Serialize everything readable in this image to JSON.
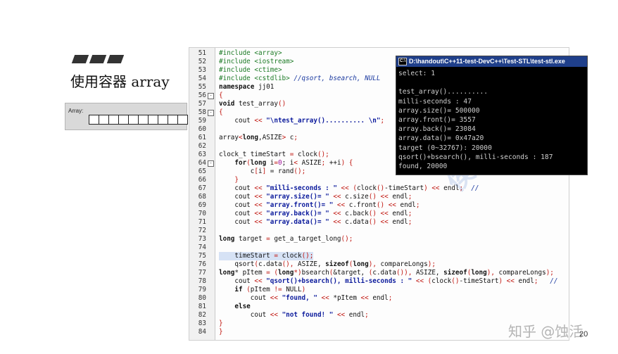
{
  "slide": {
    "title": "使用容器 array",
    "array_label": "Array:",
    "array_cells": 10,
    "page_number": "20",
    "site_watermark": "知乎 @蚀活"
  },
  "console": {
    "title": "D:\\handout\\C++11-test-DevC++\\Test-STL\\test-stl.exe",
    "lines": [
      "select: 1",
      "",
      "test_array()..........",
      "milli-seconds : 47",
      "array.size()= 500000",
      "array.front()= 3557",
      "array.back()= 23084",
      "array.data()= 0x47a20",
      "target (0~32767): 20000",
      "qsort()+bsearch(), milli-seconds : 187",
      "found, 20000"
    ]
  },
  "code": {
    "watermark": "侯捷 博览",
    "lines": [
      {
        "num": "51",
        "fold": "",
        "segs": [
          {
            "t": "#include <array>",
            "c": "pp"
          }
        ]
      },
      {
        "num": "52",
        "fold": "",
        "segs": [
          {
            "t": "#include <iostream>",
            "c": "pp"
          }
        ]
      },
      {
        "num": "53",
        "fold": "",
        "segs": [
          {
            "t": "#include <ctime>",
            "c": "pp"
          }
        ]
      },
      {
        "num": "54",
        "fold": "",
        "segs": [
          {
            "t": "#include <cstdlib>",
            "c": "pp"
          },
          {
            "t": " //qsort, bsearch, NULL",
            "c": "cm"
          }
        ]
      },
      {
        "num": "55",
        "fold": "",
        "segs": [
          {
            "t": "namespace",
            "c": "kw"
          },
          {
            "t": " jj01",
            "c": ""
          }
        ]
      },
      {
        "num": "56",
        "fold": "-",
        "segs": [
          {
            "t": "{",
            "c": "op"
          }
        ]
      },
      {
        "num": "57",
        "fold": "",
        "segs": [
          {
            "t": "void",
            "c": "kw"
          },
          {
            "t": " test_array",
            "c": ""
          },
          {
            "t": "()",
            "c": "op"
          }
        ]
      },
      {
        "num": "58",
        "fold": "-",
        "segs": [
          {
            "t": "{",
            "c": "op"
          }
        ]
      },
      {
        "num": "59",
        "fold": "",
        "segs": [
          {
            "t": "    cout ",
            "c": ""
          },
          {
            "t": "<<",
            "c": "op"
          },
          {
            "t": " \"\\ntest_array().......... \\n\"",
            "c": "str"
          },
          {
            "t": ";",
            "c": "op"
          }
        ]
      },
      {
        "num": "60",
        "fold": "",
        "segs": []
      },
      {
        "num": "61",
        "fold": "",
        "segs": [
          {
            "t": "array",
            "c": ""
          },
          {
            "t": "<",
            "c": "op"
          },
          {
            "t": "long",
            "c": "kw"
          },
          {
            "t": ",ASIZE",
            "c": ""
          },
          {
            "t": ">",
            "c": "op"
          },
          {
            "t": " c",
            "c": ""
          },
          {
            "t": ";",
            "c": "op"
          }
        ]
      },
      {
        "num": "62",
        "fold": "",
        "segs": []
      },
      {
        "num": "63",
        "fold": "",
        "segs": [
          {
            "t": "clock_t timeStart ",
            "c": ""
          },
          {
            "t": "=",
            "c": "op"
          },
          {
            "t": " clock",
            "c": ""
          },
          {
            "t": "();",
            "c": "op"
          }
        ]
      },
      {
        "num": "64",
        "fold": "-",
        "segs": [
          {
            "t": "    for",
            "c": "kw"
          },
          {
            "t": "(",
            "c": "op"
          },
          {
            "t": "long",
            "c": "kw"
          },
          {
            "t": " i",
            "c": ""
          },
          {
            "t": "=",
            "c": "op"
          },
          {
            "t": "0",
            "c": "nm"
          },
          {
            "t": "; i",
            "c": ""
          },
          {
            "t": "<",
            "c": "op"
          },
          {
            "t": " ASIZE",
            "c": ""
          },
          {
            "t": ";",
            "c": "op"
          },
          {
            "t": " ++i",
            "c": ""
          },
          {
            "t": ") {",
            "c": "op"
          }
        ]
      },
      {
        "num": "65",
        "fold": "",
        "segs": [
          {
            "t": "        c",
            "c": ""
          },
          {
            "t": "[",
            "c": "op"
          },
          {
            "t": "i",
            "c": ""
          },
          {
            "t": "]",
            "c": "op"
          },
          {
            "t": " = rand",
            "c": ""
          },
          {
            "t": "();",
            "c": "op"
          }
        ]
      },
      {
        "num": "66",
        "fold": "",
        "segs": [
          {
            "t": "    }",
            "c": "op"
          }
        ]
      },
      {
        "num": "67",
        "fold": "",
        "segs": [
          {
            "t": "    cout ",
            "c": ""
          },
          {
            "t": "<<",
            "c": "op"
          },
          {
            "t": " \"milli-seconds : \"",
            "c": "str"
          },
          {
            "t": " << (",
            "c": "op"
          },
          {
            "t": "clock",
            "c": ""
          },
          {
            "t": "()",
            "c": "op"
          },
          {
            "t": "-timeStart",
            "c": ""
          },
          {
            "t": ") << ",
            "c": "op"
          },
          {
            "t": "endl",
            "c": ""
          },
          {
            "t": ";",
            "c": "op"
          },
          {
            "t": "  //",
            "c": "cm"
          }
        ]
      },
      {
        "num": "68",
        "fold": "",
        "segs": [
          {
            "t": "    cout ",
            "c": ""
          },
          {
            "t": "<<",
            "c": "op"
          },
          {
            "t": " \"array.size()= \"",
            "c": "str"
          },
          {
            "t": " << ",
            "c": "op"
          },
          {
            "t": "c.size",
            "c": ""
          },
          {
            "t": "() << ",
            "c": "op"
          },
          {
            "t": "endl",
            "c": ""
          },
          {
            "t": ";",
            "c": "op"
          }
        ]
      },
      {
        "num": "69",
        "fold": "",
        "segs": [
          {
            "t": "    cout ",
            "c": ""
          },
          {
            "t": "<<",
            "c": "op"
          },
          {
            "t": " \"array.front()= \"",
            "c": "str"
          },
          {
            "t": " << ",
            "c": "op"
          },
          {
            "t": "c.front",
            "c": ""
          },
          {
            "t": "() << ",
            "c": "op"
          },
          {
            "t": "endl",
            "c": ""
          },
          {
            "t": ";",
            "c": "op"
          }
        ]
      },
      {
        "num": "70",
        "fold": "",
        "segs": [
          {
            "t": "    cout ",
            "c": ""
          },
          {
            "t": "<<",
            "c": "op"
          },
          {
            "t": " \"array.back()= \"",
            "c": "str"
          },
          {
            "t": " << ",
            "c": "op"
          },
          {
            "t": "c.back",
            "c": ""
          },
          {
            "t": "() << ",
            "c": "op"
          },
          {
            "t": "endl",
            "c": ""
          },
          {
            "t": ";",
            "c": "op"
          }
        ]
      },
      {
        "num": "71",
        "fold": "",
        "segs": [
          {
            "t": "    cout ",
            "c": ""
          },
          {
            "t": "<<",
            "c": "op"
          },
          {
            "t": " \"array.data()= \"",
            "c": "str"
          },
          {
            "t": " << ",
            "c": "op"
          },
          {
            "t": "c.data",
            "c": ""
          },
          {
            "t": "() << ",
            "c": "op"
          },
          {
            "t": "endl",
            "c": ""
          },
          {
            "t": ";",
            "c": "op"
          }
        ]
      },
      {
        "num": "72",
        "fold": "",
        "segs": []
      },
      {
        "num": "73",
        "fold": "",
        "segs": [
          {
            "t": "long",
            "c": "kw"
          },
          {
            "t": " target ",
            "c": ""
          },
          {
            "t": "=",
            "c": "op"
          },
          {
            "t": " get_a_target_long",
            "c": ""
          },
          {
            "t": "();",
            "c": "op"
          }
        ]
      },
      {
        "num": "74",
        "fold": "",
        "segs": []
      },
      {
        "num": "75",
        "fold": "",
        "hl": true,
        "segs": [
          {
            "t": "    timeStart ",
            "c": ""
          },
          {
            "t": "=",
            "c": "op"
          },
          {
            "t": " clock",
            "c": ""
          },
          {
            "t": "();",
            "c": "op"
          }
        ]
      },
      {
        "num": "76",
        "fold": "",
        "segs": [
          {
            "t": "    qsort",
            "c": ""
          },
          {
            "t": "(",
            "c": "op"
          },
          {
            "t": "c.data",
            "c": ""
          },
          {
            "t": "(),",
            "c": "op"
          },
          {
            "t": " ASIZE, ",
            "c": ""
          },
          {
            "t": "sizeof",
            "c": "kw"
          },
          {
            "t": "(",
            "c": "op"
          },
          {
            "t": "long",
            "c": "kw"
          },
          {
            "t": "),",
            "c": "op"
          },
          {
            "t": " compareLongs",
            "c": ""
          },
          {
            "t": ");",
            "c": "op"
          }
        ]
      },
      {
        "num": "77",
        "fold": "",
        "segs": [
          {
            "t": "long",
            "c": "kw"
          },
          {
            "t": "* pItem ",
            "c": ""
          },
          {
            "t": "=",
            "c": "op"
          },
          {
            "t": " (",
            "c": "op"
          },
          {
            "t": "long",
            "c": "kw"
          },
          {
            "t": "*)",
            "c": "op"
          },
          {
            "t": "bsearch",
            "c": ""
          },
          {
            "t": "(",
            "c": "op"
          },
          {
            "t": "&target, ",
            "c": ""
          },
          {
            "t": "(",
            "c": "op"
          },
          {
            "t": "c.data",
            "c": ""
          },
          {
            "t": "()),",
            "c": "op"
          },
          {
            "t": " ASIZE, ",
            "c": ""
          },
          {
            "t": "sizeof",
            "c": "kw"
          },
          {
            "t": "(",
            "c": "op"
          },
          {
            "t": "long",
            "c": "kw"
          },
          {
            "t": "),",
            "c": "op"
          },
          {
            "t": " compareLongs",
            "c": ""
          },
          {
            "t": ");",
            "c": "op"
          }
        ]
      },
      {
        "num": "78",
        "fold": "",
        "segs": [
          {
            "t": "    cout ",
            "c": ""
          },
          {
            "t": "<<",
            "c": "op"
          },
          {
            "t": " \"qsort()+bsearch(), milli-seconds : \"",
            "c": "str"
          },
          {
            "t": " << (",
            "c": "op"
          },
          {
            "t": "clock",
            "c": ""
          },
          {
            "t": "()",
            "c": "op"
          },
          {
            "t": "-timeStart",
            "c": ""
          },
          {
            "t": ") << ",
            "c": "op"
          },
          {
            "t": "endl",
            "c": ""
          },
          {
            "t": ";",
            "c": "op"
          },
          {
            "t": "   //",
            "c": "cm"
          }
        ]
      },
      {
        "num": "79",
        "fold": "",
        "segs": [
          {
            "t": "    if",
            "c": "kw"
          },
          {
            "t": " (",
            "c": "op"
          },
          {
            "t": "pItem ",
            "c": ""
          },
          {
            "t": "!=",
            "c": "op"
          },
          {
            "t": " NULL",
            "c": ""
          },
          {
            "t": ")",
            "c": "op"
          }
        ]
      },
      {
        "num": "80",
        "fold": "",
        "segs": [
          {
            "t": "        cout ",
            "c": ""
          },
          {
            "t": "<<",
            "c": "op"
          },
          {
            "t": " \"found, \"",
            "c": "str"
          },
          {
            "t": " << ",
            "c": "op"
          },
          {
            "t": "*pItem ",
            "c": ""
          },
          {
            "t": "<<",
            "c": "op"
          },
          {
            "t": " endl",
            "c": ""
          },
          {
            "t": ";",
            "c": "op"
          }
        ]
      },
      {
        "num": "81",
        "fold": "",
        "segs": [
          {
            "t": "    else",
            "c": "kw"
          }
        ]
      },
      {
        "num": "82",
        "fold": "",
        "segs": [
          {
            "t": "        cout ",
            "c": ""
          },
          {
            "t": "<<",
            "c": "op"
          },
          {
            "t": " \"not found! \"",
            "c": "str"
          },
          {
            "t": " << ",
            "c": "op"
          },
          {
            "t": "endl",
            "c": ""
          },
          {
            "t": ";",
            "c": "op"
          }
        ]
      },
      {
        "num": "83",
        "fold": "",
        "segs": [
          {
            "t": "}",
            "c": "op"
          }
        ]
      },
      {
        "num": "84",
        "fold": "",
        "segs": [
          {
            "t": "}",
            "c": "op"
          }
        ]
      }
    ]
  }
}
